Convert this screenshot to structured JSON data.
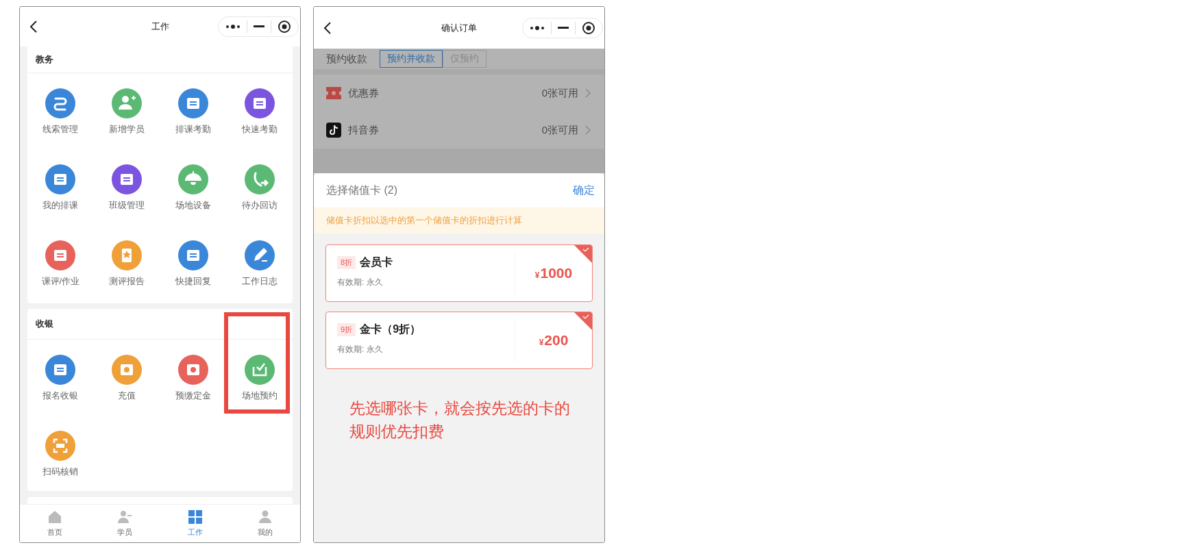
{
  "left_screen": {
    "nav": {
      "title": "工作"
    },
    "sections": [
      {
        "title": "教务",
        "items": [
          {
            "label": "线索管理",
            "color": "#3a86d9",
            "highlighted": false
          },
          {
            "label": "新增学员",
            "color": "#5bb974",
            "highlighted": false
          },
          {
            "label": "排课考勤",
            "color": "#3a86d9",
            "highlighted": false
          },
          {
            "label": "快速考勤",
            "color": "#7b55e0",
            "highlighted": false
          },
          {
            "label": "我的排课",
            "color": "#3a86d9",
            "highlighted": false
          },
          {
            "label": "班级管理",
            "color": "#7b55e0",
            "highlighted": false
          },
          {
            "label": "场地设备",
            "color": "#5bb974",
            "highlighted": false
          },
          {
            "label": "待办回访",
            "color": "#5bb974",
            "highlighted": false
          },
          {
            "label": "课评/作业",
            "color": "#e8625c",
            "highlighted": false
          },
          {
            "label": "测评报告",
            "color": "#f0a038",
            "highlighted": false
          },
          {
            "label": "快捷回复",
            "color": "#3a86d9",
            "highlighted": false
          },
          {
            "label": "工作日志",
            "color": "#3a86d9",
            "highlighted": false
          }
        ]
      },
      {
        "title": "收银",
        "items": [
          {
            "label": "报名收银",
            "color": "#3a86d9",
            "highlighted": false
          },
          {
            "label": "充值",
            "color": "#f0a038",
            "highlighted": false
          },
          {
            "label": "预缴定金",
            "color": "#e8625c",
            "highlighted": false
          },
          {
            "label": "场地预约",
            "color": "#5bb974",
            "highlighted": true
          },
          {
            "label": "扫码核销",
            "color": "#f0a038",
            "highlighted": false
          }
        ]
      }
    ],
    "tab_bar": [
      {
        "label": "首页",
        "selected": false
      },
      {
        "label": "学员",
        "selected": false
      },
      {
        "label": "工作",
        "selected": true
      },
      {
        "label": "我的",
        "selected": false
      }
    ]
  },
  "right_screen": {
    "nav": {
      "title": "确认订单"
    },
    "booking": {
      "label": "预约收款",
      "options": [
        {
          "label": "预约并收款",
          "selected": true
        },
        {
          "label": "仅预约",
          "selected": false
        }
      ]
    },
    "vouchers": [
      {
        "kind": "coupon",
        "label": "优惠券",
        "value": "0张可用"
      },
      {
        "kind": "douyin",
        "label": "抖音券",
        "value": "0张可用"
      }
    ],
    "sheet": {
      "title": "选择储值卡 (2)",
      "confirm": "确定",
      "notice": "储值卡折扣以选中的第一个储值卡的折扣进行计算",
      "cards": [
        {
          "discount": "8折",
          "name": "会员卡",
          "validity": "有效期: 永久",
          "currency": "¥",
          "amount": "1000",
          "selected": true
        },
        {
          "discount": "9折",
          "name": "金卡（9折）",
          "validity": "有效期: 永久",
          "currency": "¥",
          "amount": "200",
          "selected": true
        }
      ]
    },
    "annotation": "先选哪张卡，就会按先选的卡的规则优先扣费"
  }
}
